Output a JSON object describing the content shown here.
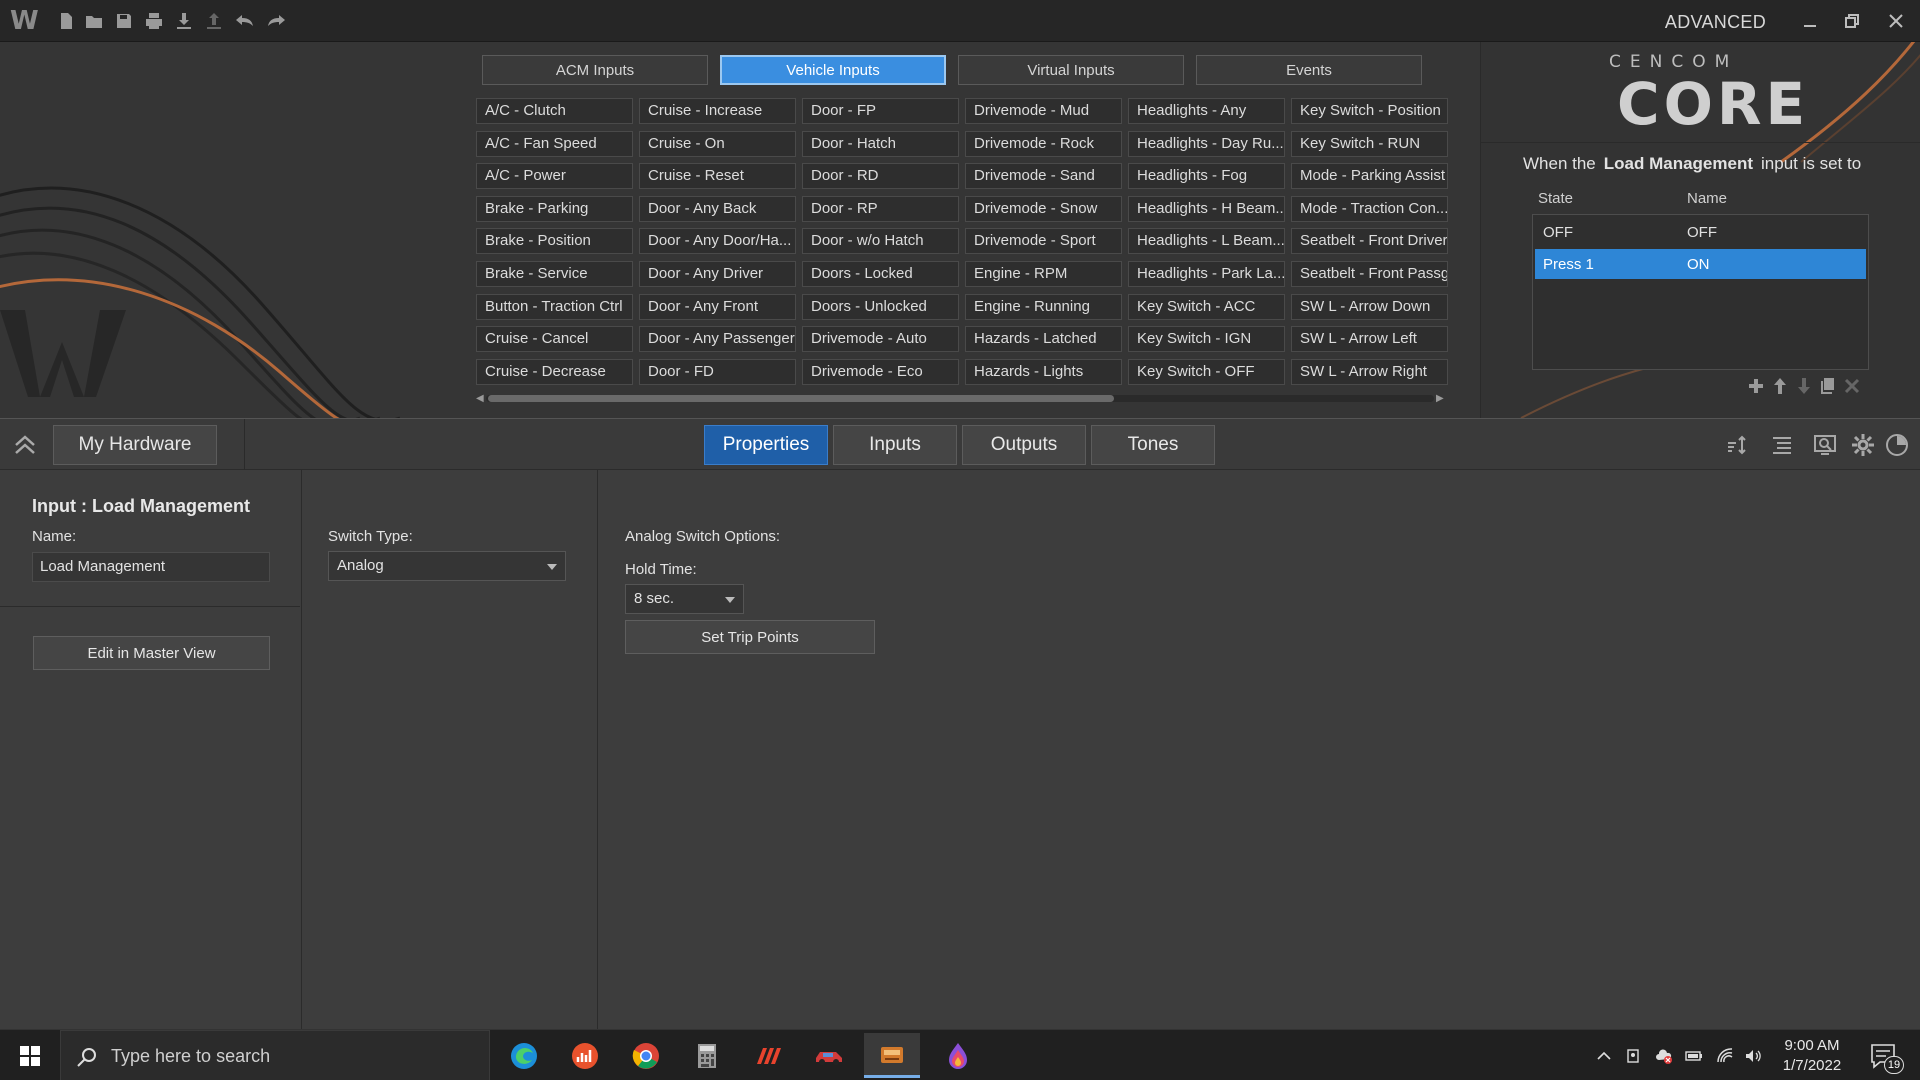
{
  "titlebar": {
    "mode": "ADVANCED"
  },
  "source_tabs": [
    {
      "label": "ACM Inputs",
      "active": false
    },
    {
      "label": "Vehicle Inputs",
      "active": true
    },
    {
      "label": "Virtual Inputs",
      "active": false
    },
    {
      "label": "Events",
      "active": false
    }
  ],
  "vehicle_inputs": [
    [
      "A/C - Clutch",
      "A/C - Fan Speed",
      "A/C - Power",
      "Brake - Parking",
      "Brake - Position",
      "Brake - Service",
      "Button - Traction Ctrl",
      "Cruise - Cancel",
      "Cruise - Decrease"
    ],
    [
      "Cruise - Increase",
      "Cruise - On",
      "Cruise - Reset",
      "Door - Any Back",
      "Door - Any Door/Ha...",
      "Door - Any Driver",
      "Door - Any Front",
      "Door - Any Passenger",
      "Door - FD"
    ],
    [
      "Door - FP",
      "Door - Hatch",
      "Door - RD",
      "Door - RP",
      "Door - w/o Hatch",
      "Doors - Locked",
      "Doors - Unlocked",
      "Drivemode - Auto",
      "Drivemode - Eco"
    ],
    [
      "Drivemode - Mud",
      "Drivemode - Rock",
      "Drivemode - Sand",
      "Drivemode - Snow",
      "Drivemode - Sport",
      "Engine - RPM",
      "Engine - Running",
      "Hazards - Latched",
      "Hazards - Lights"
    ],
    [
      "Headlights - Any",
      "Headlights - Day Ru...",
      "Headlights - Fog",
      "Headlights - H Beam...",
      "Headlights - L Beam...",
      "Headlights - Park La...",
      "Key Switch - ACC",
      "Key Switch - IGN",
      "Key Switch - OFF"
    ],
    [
      "Key Switch - Position",
      "Key Switch - RUN",
      "Mode - Parking Assist",
      "Mode - Traction Con...",
      "Seatbelt - Front Driver",
      "Seatbelt - Front Passgr",
      "SW L - Arrow Down",
      "SW L - Arrow Left",
      "SW L - Arrow Right"
    ]
  ],
  "brand": {
    "small": "CENCOM",
    "big": "CORE"
  },
  "state_panel": {
    "caption_prefix": "When the",
    "input_name": "Load Management",
    "caption_suffix": "input is set to",
    "col_state": "State",
    "col_name": "Name",
    "rows": [
      {
        "state": "OFF",
        "name": "OFF",
        "selected": false
      },
      {
        "state": "Press 1",
        "name": "ON",
        "selected": true
      }
    ]
  },
  "toolbar": {
    "hardware_label": "My Hardware",
    "tabs": [
      {
        "label": "Properties",
        "active": true
      },
      {
        "label": "Inputs",
        "active": false
      },
      {
        "label": "Outputs",
        "active": false
      },
      {
        "label": "Tones",
        "active": false
      }
    ]
  },
  "properties": {
    "input_title": "Input : Load Management",
    "name_label": "Name:",
    "name_value": "Load Management",
    "edit_master_label": "Edit in Master View",
    "switch_type_label": "Switch Type:",
    "switch_type_value": "Analog",
    "analog_options_label": "Analog Switch Options:",
    "hold_time_label": "Hold Time:",
    "hold_time_value": "8 sec.",
    "trip_points_label": "Set Trip Points"
  },
  "taskbar": {
    "search_placeholder": "Type here to search",
    "time": "9:00 AM",
    "date": "1/7/2022",
    "notification_count": "19"
  },
  "colors": {
    "accent": "#3a8ee0",
    "selected_row": "#2e86d6",
    "active_tab": "#1f5fa8",
    "brand_orange": "#b4683a"
  }
}
